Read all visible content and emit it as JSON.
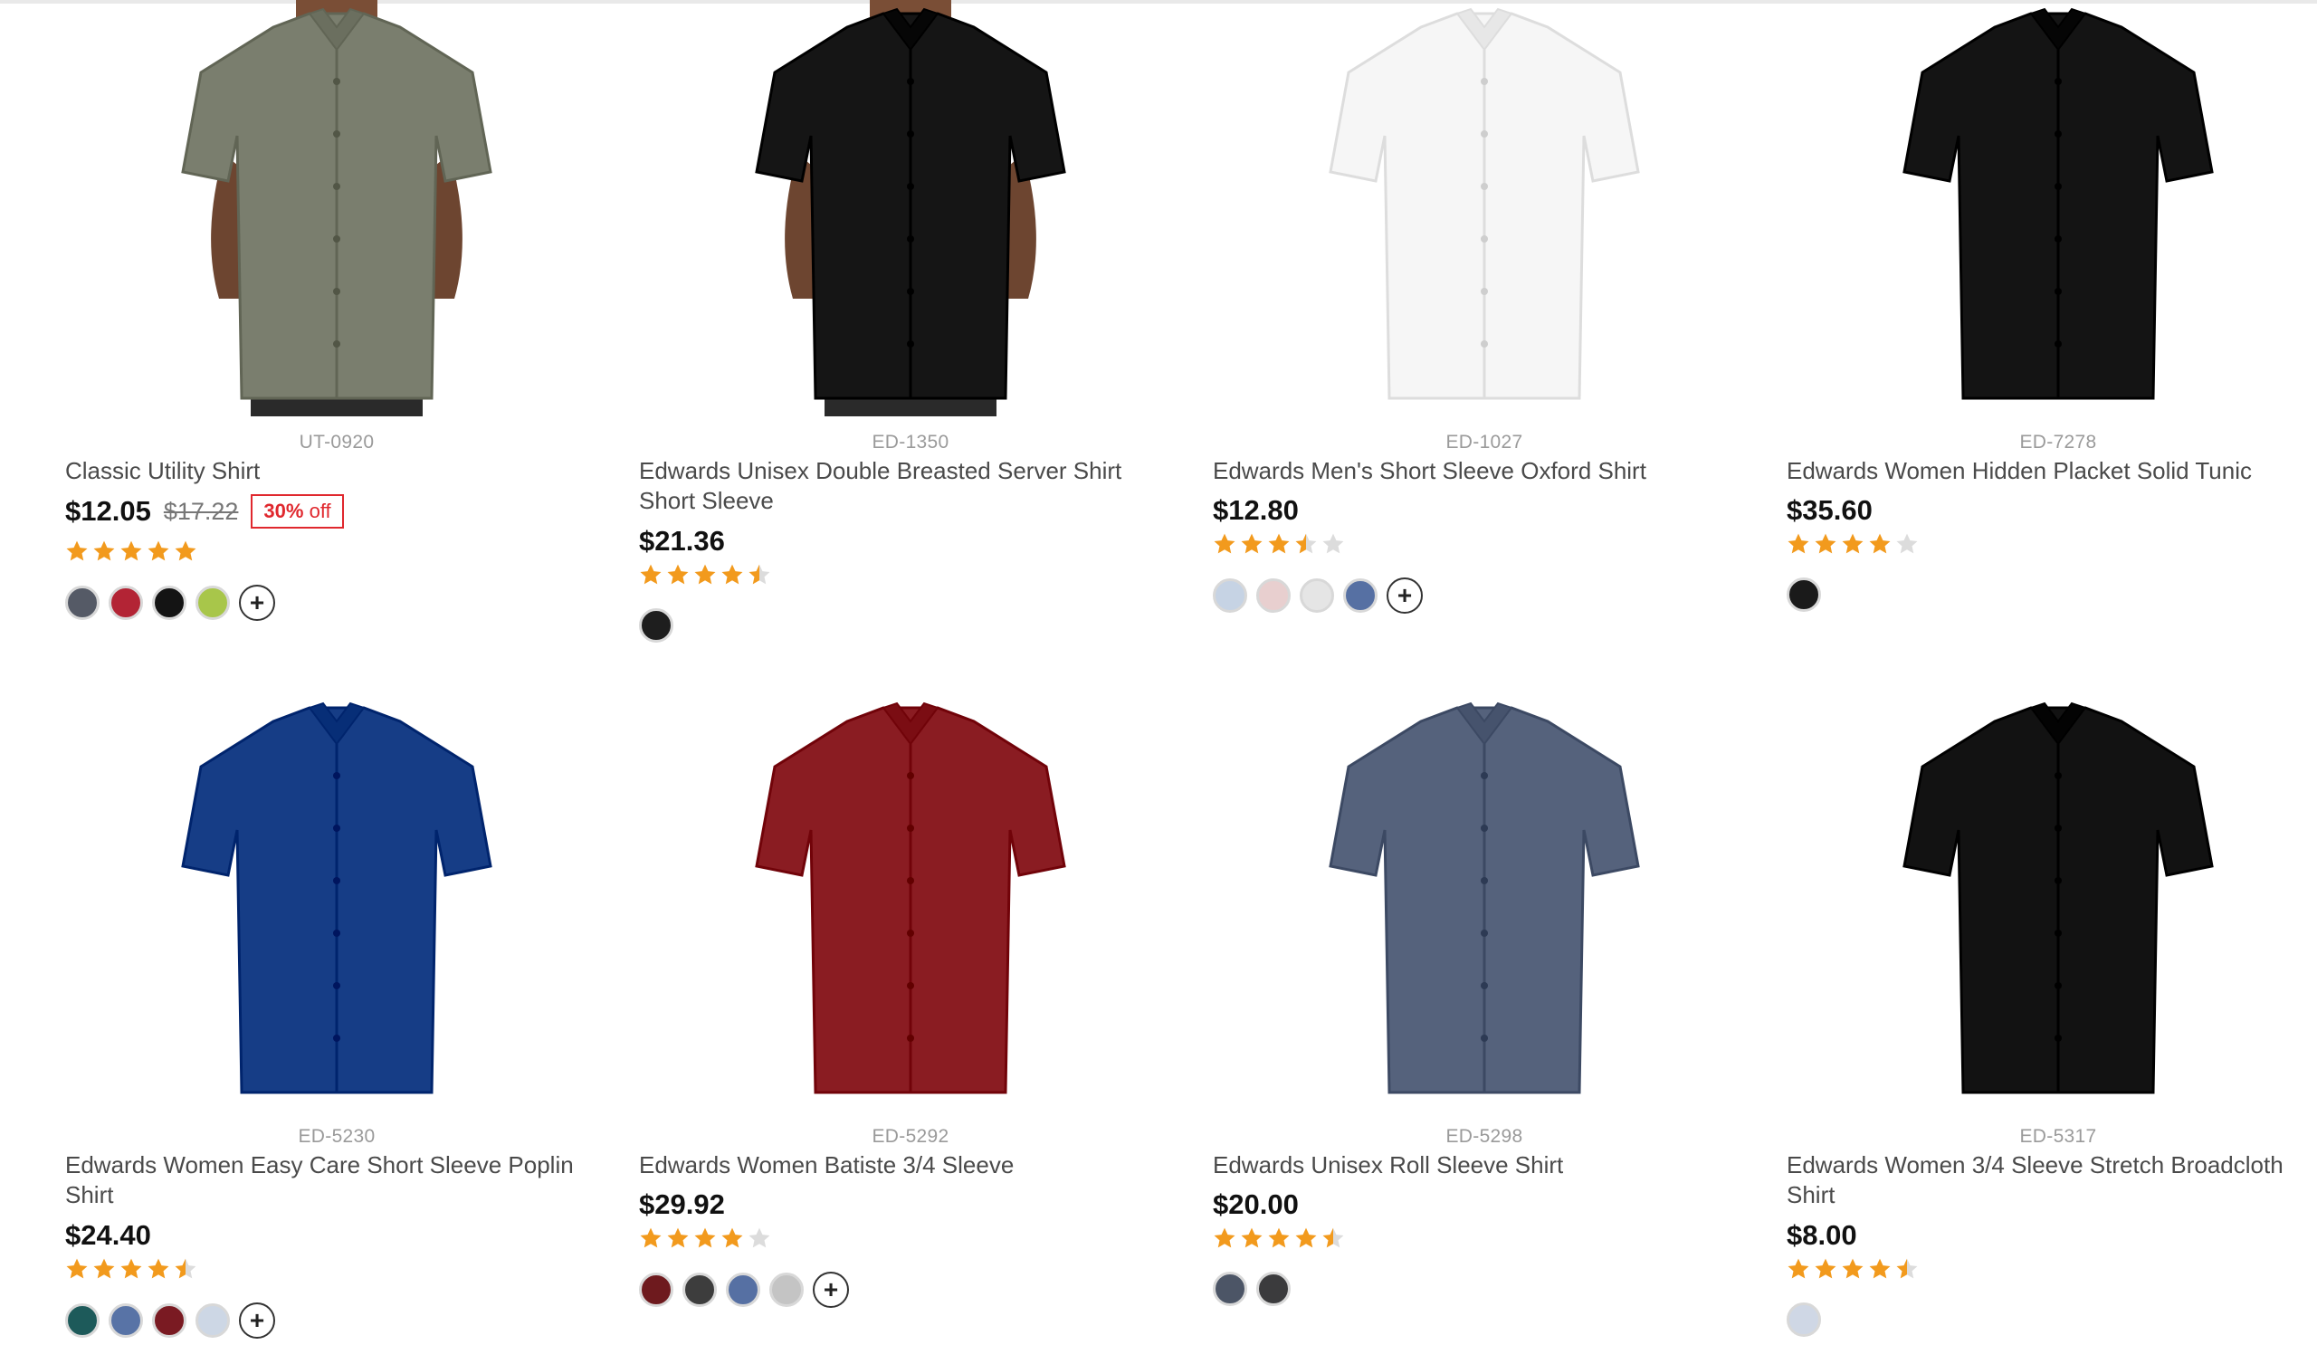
{
  "products": [
    {
      "sku": "UT-0920",
      "title": "Classic Utility Shirt",
      "price": "$12.05",
      "old_price": "$17.22",
      "discount_pct": "30%",
      "discount_word": "off",
      "rating": 5,
      "colors": [
        "#555a66",
        "#b32435",
        "#141414",
        "#a8c64a"
      ],
      "more": true,
      "shirt": "#7a7e6e",
      "model": true
    },
    {
      "sku": "ED-1350",
      "title": "Edwards Unisex Double Breasted Server Shirt Short Sleeve",
      "price": "$21.36",
      "rating": 4.5,
      "colors": [
        "#1e1e1e"
      ],
      "more": false,
      "shirt": "#151515",
      "model": true
    },
    {
      "sku": "ED-1027",
      "title": "Edwards Men's Short Sleeve Oxford Shirt",
      "price": "$12.80",
      "rating": 3.5,
      "colors": [
        "#c6d3e4",
        "#e8cfcf",
        "#e5e5e5",
        "#5670a3"
      ],
      "more": true,
      "shirt": "#f6f6f6",
      "model": false
    },
    {
      "sku": "ED-7278",
      "title": "Edwards Women Hidden Placket Solid Tunic",
      "price": "$35.60",
      "rating": 4,
      "colors": [
        "#1a1a1a"
      ],
      "more": false,
      "shirt": "#141414",
      "model": false
    },
    {
      "sku": "ED-5230",
      "title": "Edwards Women Easy Care Short Sleeve Poplin Shirt",
      "price": "$24.40",
      "rating": 4.5,
      "colors": [
        "#1d5a5a",
        "#5873a6",
        "#7a1a22",
        "#cdd7e5"
      ],
      "more": true,
      "shirt": "#163d86",
      "model": false
    },
    {
      "sku": "ED-5292",
      "title": "Edwards Women Batiste 3/4 Sleeve",
      "price": "$29.92",
      "rating": 4,
      "colors": [
        "#6e1a1e",
        "#3d3d3d",
        "#5670a3",
        "#c4c4c4"
      ],
      "more": true,
      "shirt": "#8a1c22",
      "model": false
    },
    {
      "sku": "ED-5298",
      "title": "Edwards Unisex Roll Sleeve Shirt",
      "price": "$20.00",
      "rating": 4.5,
      "colors": [
        "#4c5566",
        "#3b3b3d"
      ],
      "more": false,
      "shirt": "#55627c",
      "model": false
    },
    {
      "sku": "ED-5317",
      "title": "Edwards Women 3/4 Sleeve Stretch Broadcloth Shirt",
      "price": "$8.00",
      "rating": 4.5,
      "colors": [
        "#cfd7e5"
      ],
      "more": false,
      "shirt": "#121212",
      "model": false
    }
  ],
  "colors": {
    "price": "#111111",
    "star": "#f29a1d",
    "star_empty": "#dcdcdc",
    "discount": "#e0282e"
  }
}
